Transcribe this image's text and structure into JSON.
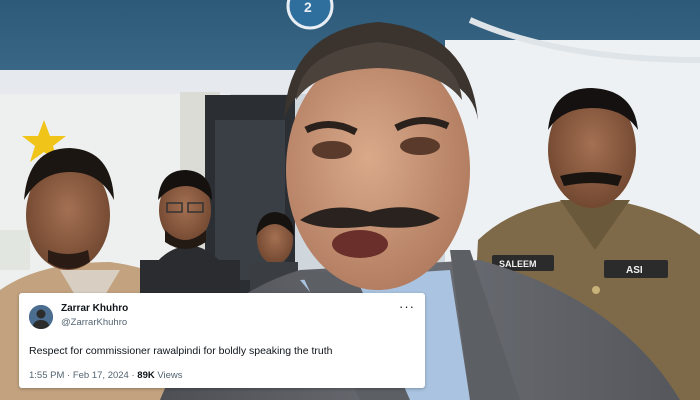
{
  "tweet": {
    "author_name": "Zarrar Khuhro",
    "author_handle": "@ZarrarKhuhro",
    "more_icon": "more-horizontal-icon",
    "text": "Respect for commissioner rawalpindi for boldly speaking the truth",
    "time": "1:55 PM",
    "separator": "·",
    "date": "Feb 17, 2024",
    "views_count": "89K",
    "views_label": "Views"
  },
  "photo": {
    "badges": [
      {
        "text": "SALEEM"
      },
      {
        "text": "ASI"
      }
    ]
  },
  "colors": {
    "card_bg": "#ffffff",
    "text_primary": "#0f1419",
    "text_secondary": "#536471",
    "police_uniform": "#7e6a48"
  }
}
